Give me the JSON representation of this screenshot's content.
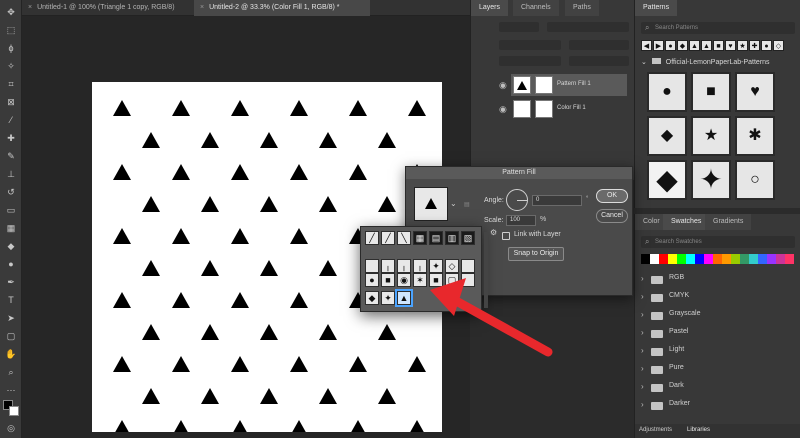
{
  "tabs": [
    {
      "label": "Untitled-1 @ 100% (Triangle 1 copy, RGB/8)",
      "active": false
    },
    {
      "label": "Untitled-2 @ 33.3% (Color Fill 1, RGB/8) *",
      "active": true
    }
  ],
  "layers_panel": {
    "tabs": [
      "Layers",
      "Channels",
      "Paths"
    ],
    "layers": [
      {
        "name": "Pattern Fill 1",
        "selected": true
      },
      {
        "name": "Color Fill 1",
        "selected": false
      }
    ]
  },
  "patterns_panel": {
    "tab": "Patterns",
    "search_placeholder": "Search Patterns",
    "group": "Official-LemonPaperLab-Patterns"
  },
  "swatches_panel": {
    "tabs": [
      "Color",
      "Swatches",
      "Gradients"
    ],
    "search_placeholder": "Search Swatches",
    "folders": [
      "RGB",
      "CMYK",
      "Grayscale",
      "Pastel",
      "Light",
      "Pure",
      "Dark",
      "Darker"
    ],
    "bottom_tabs": [
      "Adjustments",
      "Libraries"
    ],
    "colors": [
      "#000000",
      "#ffffff",
      "#ff0000",
      "#ffff00",
      "#00ff00",
      "#00ffff",
      "#0000ff",
      "#ff00ff",
      "#ff6600",
      "#ff9900",
      "#99cc00",
      "#339966",
      "#33cccc",
      "#3366ff",
      "#9933ff",
      "#cc3399",
      "#ff3366"
    ]
  },
  "pattern_fill_dialog": {
    "title": "Pattern Fill",
    "angle_label": "Angle:",
    "angle_value": "0",
    "scale_label": "Scale:",
    "scale_value": "100",
    "scale_unit": "%",
    "ok_label": "OK",
    "cancel_label": "Cancel",
    "link_label": "Link with Layer",
    "snap_label": "Snap to Origin"
  },
  "canvas": {
    "background": "#ffffff",
    "mark_color": "#000000"
  },
  "accent": {
    "arrow": "#e8282c",
    "selection": "#4aa3ff"
  }
}
